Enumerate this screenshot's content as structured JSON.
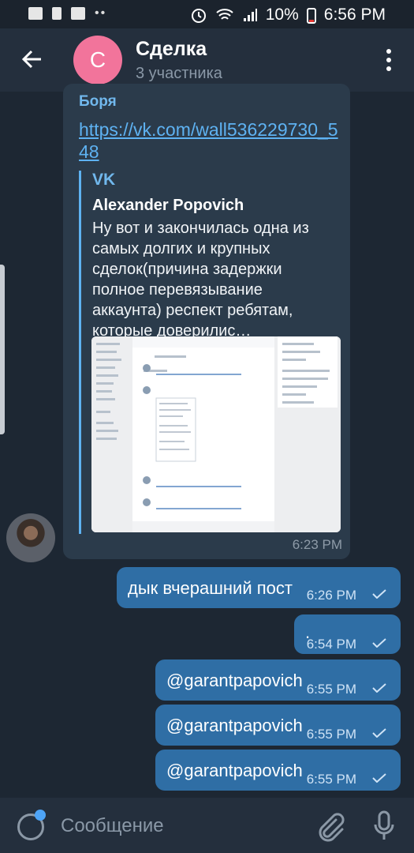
{
  "status_bar": {
    "battery": "10%",
    "time": "6:56 PM"
  },
  "header": {
    "avatar_letter": "С",
    "title": "Сделка",
    "subtitle": "3 участника"
  },
  "incoming": {
    "sender": "Боря",
    "link": "https://vk.com/wall536229730_548",
    "preview": {
      "site": "VK",
      "author": "Alexander Popovich",
      "text": "Ну вот и закончилась одна из самых долгих и крупных сделок(причина задержки полное перевязывание аккаунта) респект ребятам, которые доверилис…"
    },
    "time": "6:23 PM"
  },
  "outgoing": [
    {
      "text": "дык вчерашний пост",
      "time": "6:26 PM"
    },
    {
      "text": ".",
      "time": "6:54 PM"
    },
    {
      "text": "@garantpapovich",
      "time": "6:55 PM"
    },
    {
      "text": "@garantpapovich",
      "time": "6:55 PM"
    },
    {
      "text": "@garantpapovich",
      "time": "6:55 PM"
    }
  ],
  "composer": {
    "placeholder": "Сообщение"
  },
  "colors": {
    "background": "#1d2733",
    "header": "#242f3d",
    "incoming_bubble": "#2b3b4b",
    "outgoing_bubble": "#2f6ea5",
    "link": "#5eb2f2",
    "avatar": "#f2749b"
  },
  "icons": [
    "mail-icon",
    "alert-icon",
    "chat-icon",
    "alarm-icon",
    "wifi-icon",
    "signal-icon",
    "battery-icon",
    "back-arrow-icon",
    "more-vert-icon",
    "emoji-icon",
    "attach-icon",
    "mic-icon",
    "check-icon"
  ]
}
